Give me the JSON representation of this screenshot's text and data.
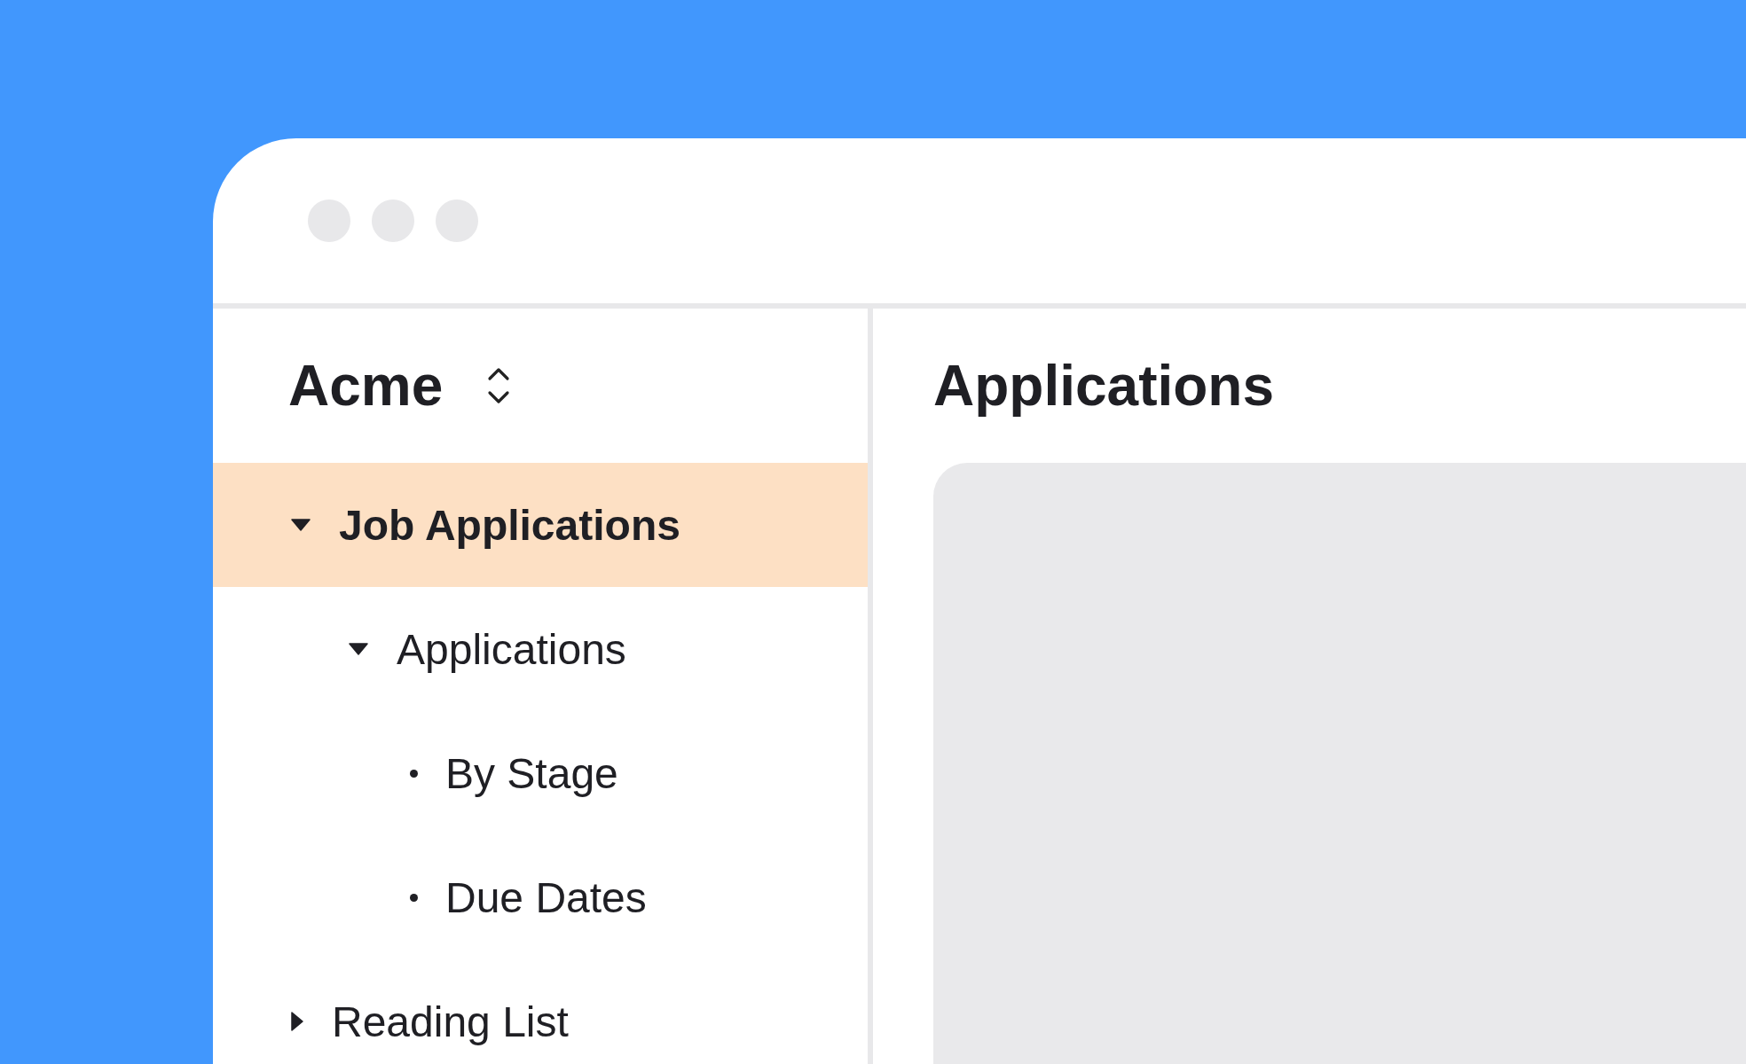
{
  "sidebar": {
    "workspace": "Acme",
    "tree": [
      {
        "label": "Job Applications",
        "kind": "folder",
        "expanded": true,
        "selected": true,
        "children": [
          {
            "label": "Applications",
            "kind": "folder",
            "expanded": true,
            "selected": false,
            "children": [
              {
                "label": "By Stage",
                "kind": "page",
                "selected": false
              },
              {
                "label": "Due Dates",
                "kind": "page",
                "selected": false
              }
            ]
          }
        ]
      },
      {
        "label": "Reading List",
        "kind": "folder",
        "expanded": false,
        "selected": false
      }
    ]
  },
  "main": {
    "title": "Applications"
  }
}
